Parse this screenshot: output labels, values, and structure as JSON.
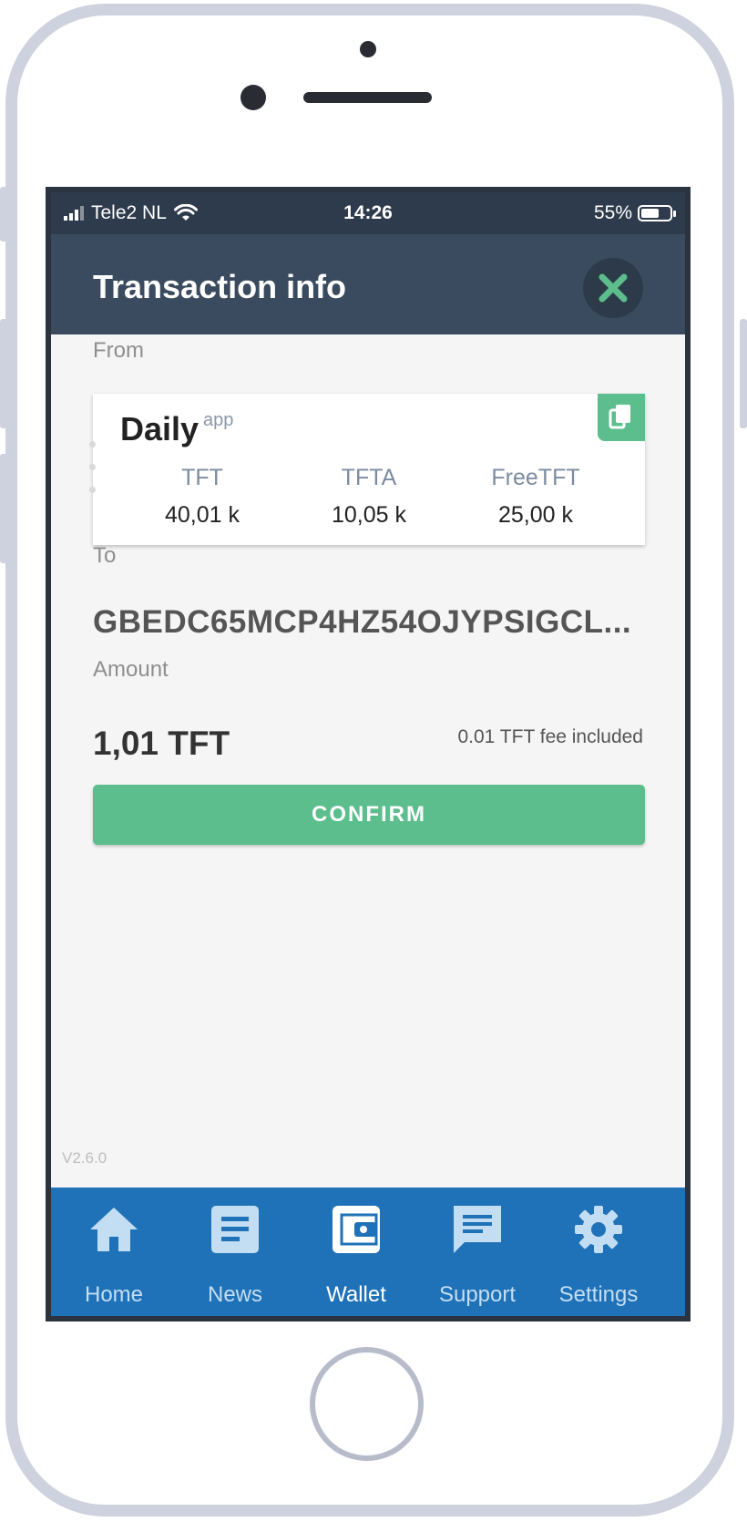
{
  "status_bar": {
    "carrier": "Tele2 NL",
    "time": "14:26",
    "battery": "55%",
    "battery_level": 0.55
  },
  "header": {
    "title": "Transaction info",
    "close_icon": "close-icon"
  },
  "from": {
    "label": "From",
    "account_name": "Daily",
    "account_tag": "app",
    "balances": [
      {
        "currency": "TFT",
        "amount": "40,01 k"
      },
      {
        "currency": "TFTA",
        "amount": "10,05 k"
      },
      {
        "currency": "FreeTFT",
        "amount": "25,00 k"
      }
    ]
  },
  "to": {
    "label": "To",
    "address": "GBEDC65MCP4HZ54OJYPSIGCL..."
  },
  "amount": {
    "label": "Amount",
    "value": "1,01 TFT",
    "fee_note": "0.01 TFT fee included"
  },
  "confirm_label": "CONFIRM",
  "version": "V2.6.0",
  "nav": {
    "items": [
      {
        "label": "Home",
        "icon": "home-icon"
      },
      {
        "label": "News",
        "icon": "news-icon"
      },
      {
        "label": "Wallet",
        "icon": "wallet-icon",
        "active": true
      },
      {
        "label": "Support",
        "icon": "chat-icon"
      },
      {
        "label": "Settings",
        "icon": "gear-icon"
      }
    ]
  },
  "colors": {
    "header": "#3a4b5f",
    "accent_green": "#5bbe8c",
    "nav_blue": "#1f72b8"
  }
}
